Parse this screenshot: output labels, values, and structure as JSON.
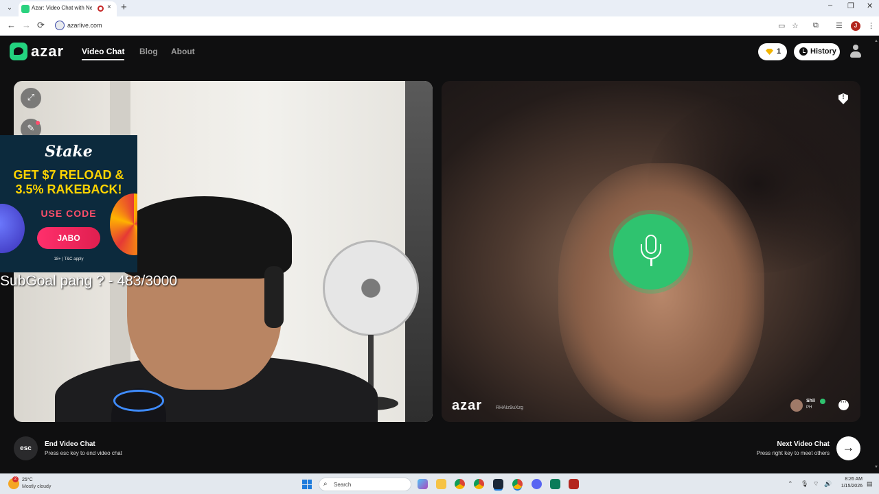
{
  "browser": {
    "tab_title": "Azar: Video Chat with New",
    "tab_close": "×",
    "new_tab": "+",
    "url": "azarlive.com",
    "nav": {
      "back": "←",
      "forward": "→",
      "reload": "⟳"
    },
    "window": {
      "minimize": "–",
      "maximize": "❐",
      "close": "✕"
    },
    "profile_initial": "J",
    "toolbar_icons": [
      "cast-icon",
      "bookmark-star-icon",
      "extensions-icon",
      "reading-list-icon",
      "menu-dots-icon"
    ]
  },
  "site": {
    "logo": "azar",
    "nav": {
      "video_chat": "Video Chat",
      "blog": "Blog",
      "about": "About"
    },
    "gems": "1",
    "history": "History",
    "accent": "#23d37f"
  },
  "ad": {
    "brand": "Stake",
    "headline_1": "GET $7 RELOAD &",
    "headline_2": "3.5% RAKEBACK!",
    "use_code": "USE CODE",
    "code": "JABO",
    "terms": "18+ | T&C apply"
  },
  "overlay": {
    "subgoal": "SubGoal pang ? - 483/3000"
  },
  "remote": {
    "watermark": "azar",
    "user_id": "RHAIz9uXzg",
    "peer_name": "Shii",
    "peer_country": "PH"
  },
  "controls": {
    "esc_key": "esc",
    "end_title": "End Video Chat",
    "end_hint": "Press esc key to end video chat",
    "next_title": "Next Video Chat",
    "next_hint": "Press right key to meet others",
    "next_arrow": "→"
  },
  "taskbar": {
    "weather_badge": "2",
    "temperature": "25°C",
    "weather": "Mostly cloudy",
    "search": "Search",
    "time": "8:26 AM",
    "date": "1/15/2026",
    "apps": [
      "copilot-icon",
      "file-explorer-icon",
      "chrome-icon",
      "chrome-icon",
      "steam-icon",
      "chrome-icon",
      "discord-icon",
      "app-icon",
      "dota-icon"
    ]
  }
}
